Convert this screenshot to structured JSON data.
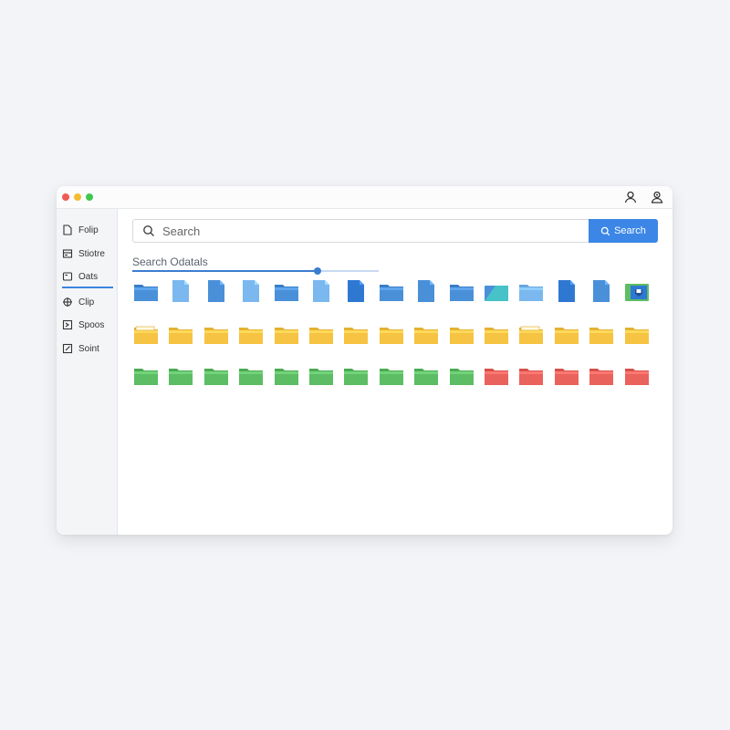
{
  "sidebar": {
    "items": [
      {
        "label": "Folip",
        "icon": "file-icon"
      },
      {
        "label": "Stiotre",
        "icon": "storage-icon"
      },
      {
        "label": "Oats",
        "icon": "folder-icon"
      },
      {
        "label": "Clip",
        "icon": "link-icon"
      },
      {
        "label": "Spoos",
        "icon": "image-icon"
      },
      {
        "label": "Soint",
        "icon": "edit-icon"
      }
    ],
    "active_index": 2
  },
  "search": {
    "placeholder": "Search",
    "button_label": "Search"
  },
  "results": {
    "label": "Search Odatals",
    "progress_fraction": 0.75
  },
  "colors": {
    "accent": "#3b86e6",
    "blue_folder": "#4a90d9",
    "blue_light": "#7ab8ef",
    "blue_dark": "#2f78d2",
    "teal": "#46c2c8",
    "yellow_folder": "#f6c343",
    "green_folder": "#5cbd64",
    "red_folder": "#e9625c"
  },
  "grid": {
    "rows": [
      [
        "folder-blue",
        "doc-light",
        "doc-blue",
        "doc-light",
        "folder-blue",
        "doc-light",
        "doc-dark",
        "folder-blue",
        "doc-blue",
        "folder-blue",
        "folder-teal",
        "folder-light",
        "doc-dark",
        "doc-blue",
        "folder-green-special"
      ],
      [
        "folder-yellow-open",
        "folder-yellow",
        "folder-yellow",
        "folder-yellow",
        "folder-yellow",
        "folder-yellow",
        "folder-yellow",
        "folder-yellow",
        "folder-yellow",
        "folder-yellow",
        "folder-yellow",
        "folder-yellow-open",
        "folder-yellow",
        "folder-yellow",
        "folder-yellow"
      ],
      [
        "folder-green",
        "folder-green",
        "folder-green",
        "folder-green",
        "folder-green",
        "folder-green",
        "folder-green",
        "folder-green",
        "folder-green",
        "folder-green",
        "folder-red",
        "folder-red",
        "folder-red",
        "folder-red",
        "folder-red"
      ]
    ]
  }
}
